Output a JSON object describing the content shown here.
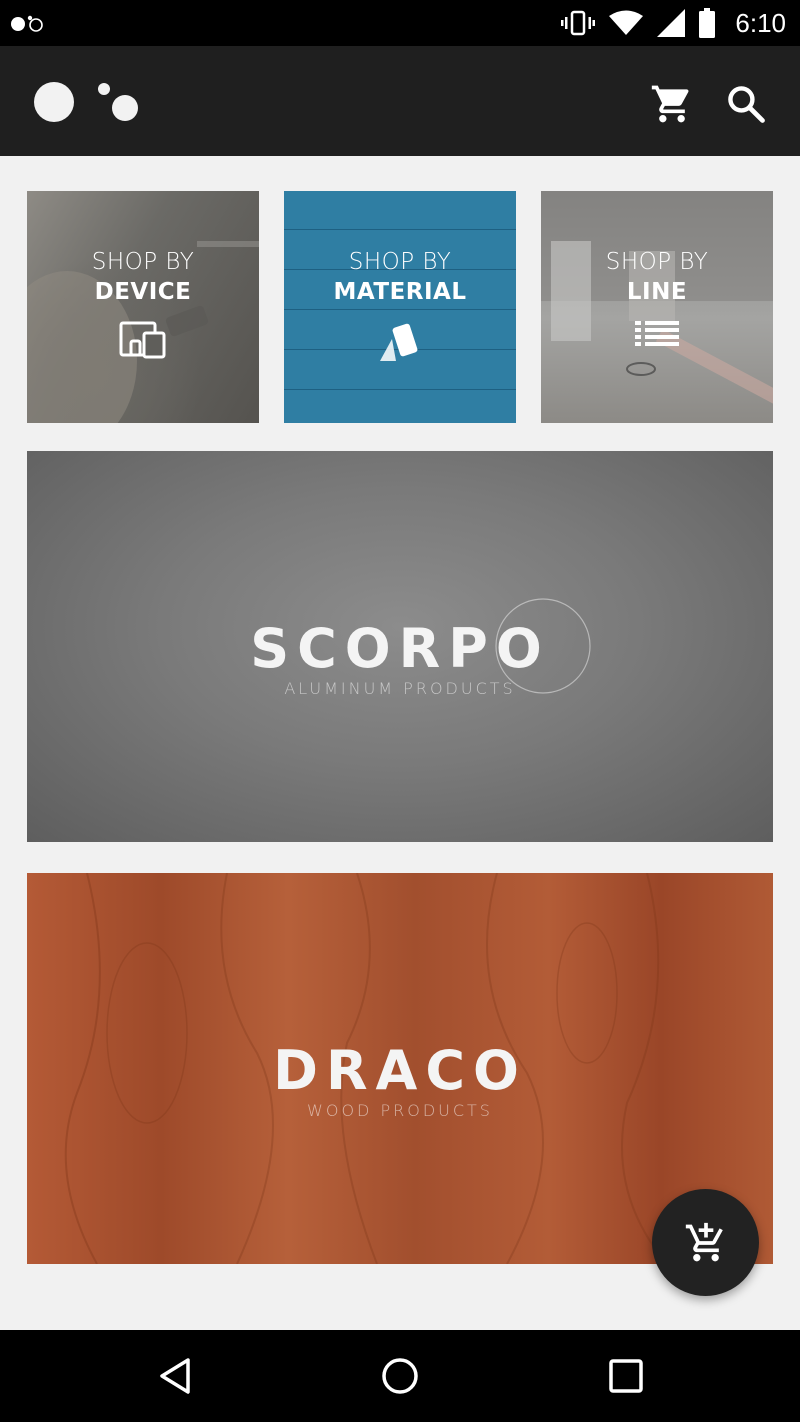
{
  "status_bar": {
    "time": "6:10",
    "icons": [
      "app-logo-mini-icon",
      "vibrate-icon",
      "wifi-icon",
      "signal-icon",
      "battery-icon"
    ]
  },
  "app_bar": {
    "icons": [
      "app-logo-icon",
      "cart-icon",
      "search-icon"
    ]
  },
  "categories": [
    {
      "top": "SHOP BY",
      "bottom": "DEVICE",
      "icon": "devices-icon"
    },
    {
      "top": "SHOP BY",
      "bottom": "MATERIAL",
      "icon": "material-swatches-icon"
    },
    {
      "top": "SHOP BY",
      "bottom": "LINE",
      "icon": "list-icon"
    }
  ],
  "banners": [
    {
      "name": "SCORP",
      "name_suffix": "O",
      "subtitle": "ALUMINUM PRODUCTS"
    },
    {
      "name": "DRAC",
      "name_suffix": "O",
      "subtitle": "WOOD PRODUCTS"
    }
  ],
  "fab": {
    "icon": "add-to-cart-icon"
  },
  "nav": {
    "icons": [
      "back-icon",
      "home-icon",
      "recents-icon"
    ]
  },
  "colors": {
    "app_bar": "#1f1f1f",
    "material_tile": "#2f7ea3",
    "scorpio_bg": "#7a7a7a",
    "draco_bg": "#a8542f"
  }
}
